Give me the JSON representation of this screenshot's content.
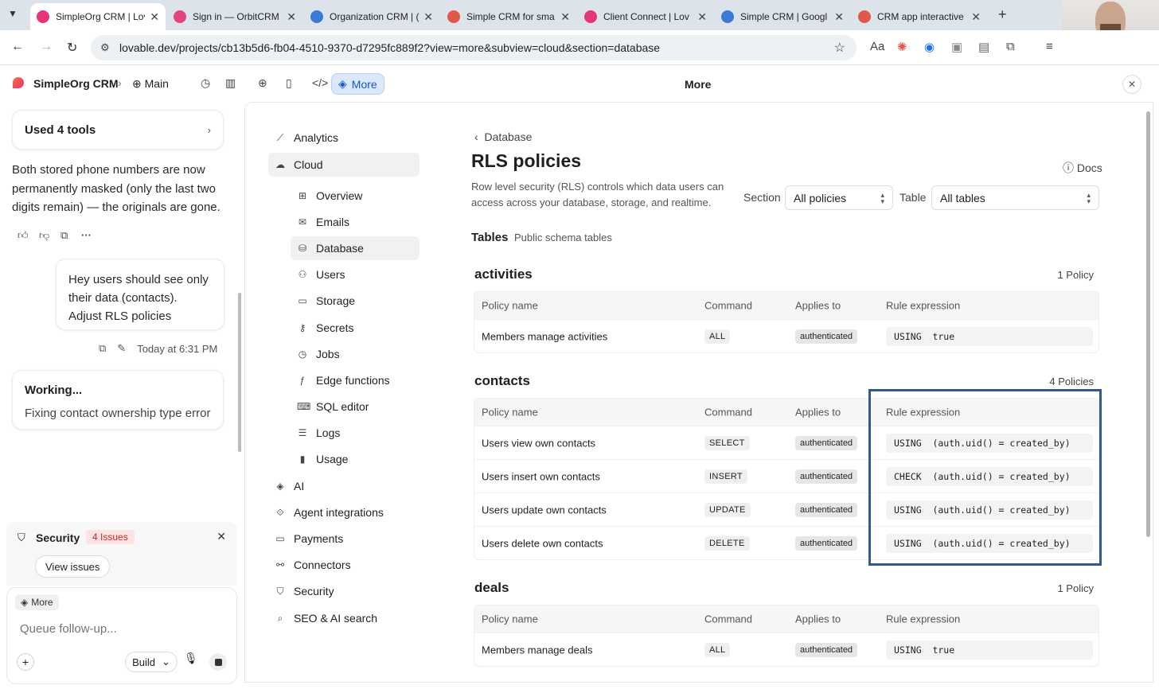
{
  "browser": {
    "tabs": [
      {
        "title": "SimpleOrg CRM | Lov",
        "favicon_color": "#e8347a",
        "active": true
      },
      {
        "title": "Sign in — OrbitCRM",
        "favicon_color": "#e0457b",
        "active": false
      },
      {
        "title": "Organization CRM | (",
        "favicon_color": "#3a7bd5",
        "active": false
      },
      {
        "title": "Simple CRM for sma",
        "favicon_color": "#e0584b",
        "active": false
      },
      {
        "title": "Client Connect | Lov",
        "favicon_color": "#e8347a",
        "active": false
      },
      {
        "title": "Simple CRM | Googl",
        "favicon_color": "#3a7bd5",
        "active": false
      },
      {
        "title": "CRM app interactive",
        "favicon_color": "#e0584b",
        "active": false
      }
    ],
    "url": "lovable.dev/projects/cb13b5d6-fb04-4510-9370-d7295fc889f2?view=more&subview=cloud&section=database"
  },
  "app": {
    "project_name": "SimpleOrg CRM",
    "branch": "Main",
    "more_label": "More",
    "view_title": "More"
  },
  "chat": {
    "tools_label": "Used 4 tools",
    "ai_message": "Both stored phone numbers are now permanently masked (only the last two digits remain) — the originals are gone.",
    "user_message": "Hey users should see only their data (contacts). Adjust RLS policies",
    "timestamp": "Today at 6:31 PM",
    "working_title": "Working...",
    "working_status": "Fixing contact ownership type error",
    "security_label": "Security",
    "security_issues": "4 Issues",
    "view_issues": "View issues",
    "more_chip": "More",
    "composer_placeholder": "Queue follow-up...",
    "build_label": "Build"
  },
  "nav": {
    "items": [
      {
        "label": "Analytics",
        "icon": "chart-icon"
      },
      {
        "label": "Cloud",
        "icon": "cloud-icon",
        "selected": true
      },
      {
        "label": "Overview",
        "icon": "grid-icon",
        "sub": true
      },
      {
        "label": "Emails",
        "icon": "mail-icon",
        "sub": true
      },
      {
        "label": "Database",
        "icon": "database-icon",
        "sub": true,
        "selected": true
      },
      {
        "label": "Users",
        "icon": "users-icon",
        "sub": true
      },
      {
        "label": "Storage",
        "icon": "storage-icon",
        "sub": true
      },
      {
        "label": "Secrets",
        "icon": "key-icon",
        "sub": true
      },
      {
        "label": "Jobs",
        "icon": "clock-icon",
        "sub": true
      },
      {
        "label": "Edge functions",
        "icon": "function-icon",
        "sub": true
      },
      {
        "label": "SQL editor",
        "icon": "terminal-icon",
        "sub": true
      },
      {
        "label": "Logs",
        "icon": "list-icon",
        "sub": true
      },
      {
        "label": "Usage",
        "icon": "bar-chart-icon",
        "sub": true
      },
      {
        "label": "AI",
        "icon": "ai-icon"
      },
      {
        "label": "Agent integrations",
        "icon": "plug-icon"
      },
      {
        "label": "Payments",
        "icon": "card-icon"
      },
      {
        "label": "Connectors",
        "icon": "connectors-icon"
      },
      {
        "label": "Security",
        "icon": "shield-icon"
      },
      {
        "label": "SEO & AI search",
        "icon": "search-icon"
      }
    ]
  },
  "rls": {
    "back_label": "Database",
    "title": "RLS policies",
    "docs_label": "Docs",
    "description": "Row level security (RLS) controls which data users can access across your database, storage, and realtime.",
    "section_label": "Section",
    "section_value": "All policies",
    "table_label": "Table",
    "table_value": "All tables",
    "tables_heading": "Tables",
    "tables_sub": "Public schema tables",
    "columns": [
      "Policy name",
      "Command",
      "Applies to",
      "Rule expression"
    ],
    "groups": [
      {
        "name": "activities",
        "count": "1 Policy",
        "rows": [
          {
            "name": "Members manage activities",
            "command": "ALL",
            "applies": "authenticated",
            "expr": "USING  true"
          }
        ]
      },
      {
        "name": "contacts",
        "count": "4 Policies",
        "rows": [
          {
            "name": "Users view own contacts",
            "command": "SELECT",
            "applies": "authenticated",
            "expr": "USING  (auth.uid() = created_by)"
          },
          {
            "name": "Users insert own contacts",
            "command": "INSERT",
            "applies": "authenticated",
            "expr": "CHECK  (auth.uid() = created_by)"
          },
          {
            "name": "Users update own contacts",
            "command": "UPDATE",
            "applies": "authenticated",
            "expr": "USING  (auth.uid() = created_by)"
          },
          {
            "name": "Users delete own contacts",
            "command": "DELETE",
            "applies": "authenticated",
            "expr": "USING  (auth.uid() = created_by)"
          }
        ]
      },
      {
        "name": "deals",
        "count": "1 Policy",
        "rows": [
          {
            "name": "Members manage deals",
            "command": "ALL",
            "applies": "authenticated",
            "expr": "USING  true"
          }
        ]
      }
    ]
  },
  "colors": {
    "accent": "#1a56c4",
    "highlight": "#2f5a93",
    "issues_red": "#c62828"
  }
}
